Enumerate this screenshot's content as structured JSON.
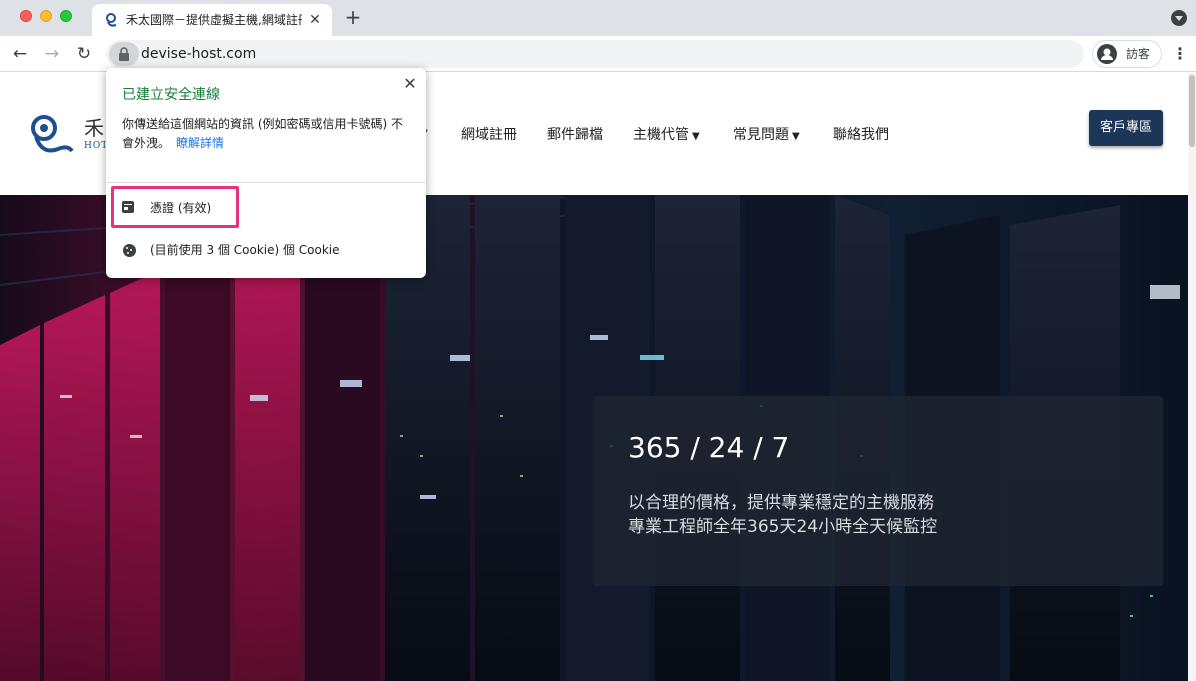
{
  "browser": {
    "tab": {
      "title": "禾太國際－提供虛擬主機,網域註冊",
      "close_glyph": "✕"
    },
    "new_tab_glyph": "+",
    "nav": {
      "back": "←",
      "forward": "→",
      "reload": "↻"
    },
    "url": "devise-host.com",
    "profile_name": "訪客",
    "menu_glyph": "⋮"
  },
  "site": {
    "logo": {
      "text": "禾",
      "sub": "HOT"
    },
    "nav_items": [
      {
        "label": "網域註冊",
        "has_dropdown": false
      },
      {
        "label": "郵件歸檔",
        "has_dropdown": false
      },
      {
        "label": "主機代管",
        "has_dropdown": true
      },
      {
        "label": "常見問題",
        "has_dropdown": true
      },
      {
        "label": "聯絡我們",
        "has_dropdown": false
      }
    ],
    "client_button": "客戶專區",
    "hero": {
      "title": "365 / 24 / 7",
      "line1": "以合理的價格，提供專業穩定的主機服務",
      "line2": "專業工程師全年365天24小時全天候監控"
    }
  },
  "popup": {
    "title": "已建立安全連線",
    "description": "你傳送給這個網站的資訊 (例如密碼或信用卡號碼) 不會外洩。",
    "learn_more": "瞭解詳情",
    "close_glyph": "✕",
    "certificate": "憑證 (有效)",
    "cookies": "(目前使用 3 個 Cookie) 個 Cookie"
  },
  "colors": {
    "secure_green": "#188038",
    "link_blue": "#1a73e8",
    "highlight_pink": "#e8327d",
    "button_navy": "#1d3557"
  },
  "icons": [
    "lock-icon",
    "certificate-icon",
    "cookie-icon",
    "profile-avatar-icon",
    "favicon-icon"
  ]
}
